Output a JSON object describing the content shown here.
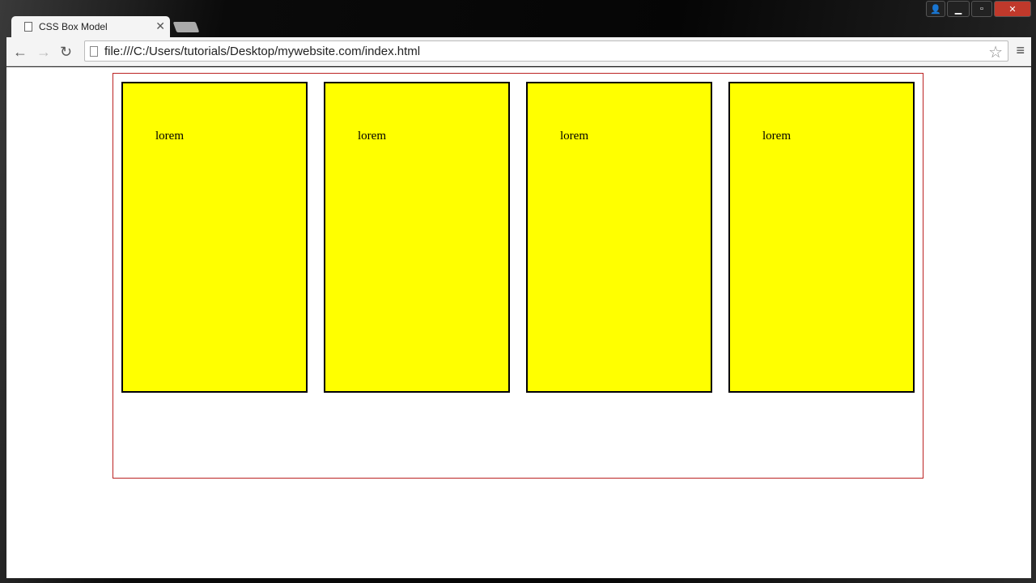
{
  "tab": {
    "title": "CSS Box Model"
  },
  "address": {
    "url": "file:///C:/Users/tutorials/Desktop/mywebsite.com/index.html"
  },
  "boxes": [
    {
      "text": "lorem"
    },
    {
      "text": "lorem"
    },
    {
      "text": "lorem"
    },
    {
      "text": "lorem"
    }
  ],
  "colors": {
    "box": "#ffff00",
    "container_border": "#b22222"
  }
}
